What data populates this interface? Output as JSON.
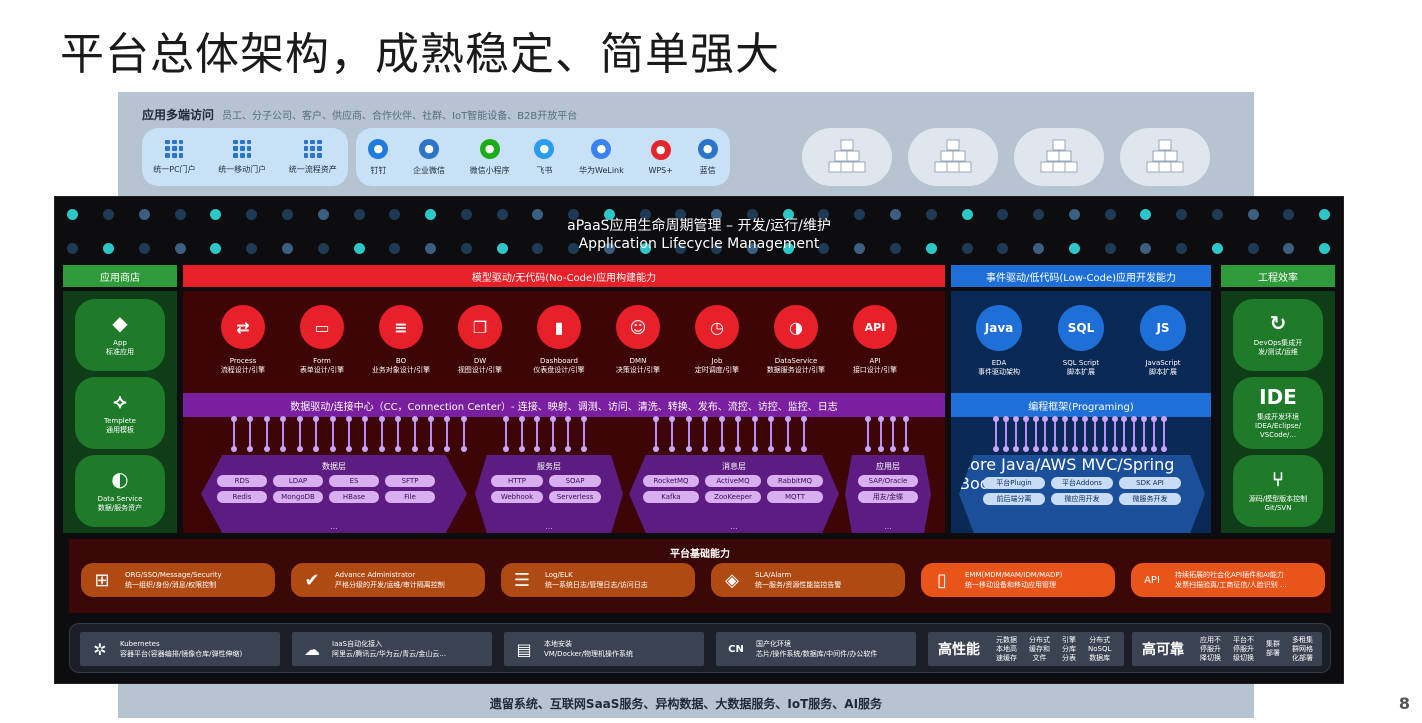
{
  "slide": {
    "title": "平台总体架构，成熟稳定、简单强大",
    "page_number": "8"
  },
  "access": {
    "header": "应用多端访问",
    "subtitle": "员工、分子公司、客户、供应商、合作伙伴、社群、IoT智能设备、B2B开放平台",
    "portals": [
      {
        "label": "统一PC门户"
      },
      {
        "label": "统一移动门户"
      },
      {
        "label": "统一流程资产"
      }
    ],
    "apps": [
      {
        "label": "钉钉",
        "icon": "dingtalk-icon",
        "color": "#1f7be0"
      },
      {
        "label": "企业微信",
        "icon": "wecom-icon",
        "color": "#2b74c9"
      },
      {
        "label": "微信小程序",
        "icon": "wechat-mini-icon",
        "color": "#1aad19"
      },
      {
        "label": "飞书",
        "icon": "feishu-icon",
        "color": "#2a9cf0"
      },
      {
        "label": "华为WeLink",
        "icon": "welink-icon",
        "color": "#3b82f6"
      },
      {
        "label": "WPS+",
        "icon": "wps-icon",
        "color": "#e3262b"
      },
      {
        "label": "蓝信",
        "icon": "lanxin-icon",
        "color": "#2b74c9"
      }
    ]
  },
  "bottom_bar": "遗留系统、互联网SaaS服务、异构数据、大数据服务、IoT服务、AI服务",
  "alm": {
    "title_cn": "aPaaS应用生命周期管理 – 开发/运行/维护",
    "title_en": "Application Lifecycle Management"
  },
  "columns": {
    "app_store": "应用商店",
    "no_code": "模型驱动/无代码(No-Code)应用构建能力",
    "low_code": "事件驱动/低代码(Low-Code)应用开发能力",
    "efficiency": "工程效率"
  },
  "app_store_items": [
    {
      "icon": "cube-icon",
      "glyph": "◆",
      "line1": "App",
      "line2": "标准应用"
    },
    {
      "icon": "template-icon",
      "glyph": "⟡",
      "line1": "Templete",
      "line2": "通用模板"
    },
    {
      "icon": "data-service-icon",
      "glyph": "◐",
      "line1": "Data Service",
      "line2": "数据/服务资产"
    }
  ],
  "no_code_items": [
    {
      "icon": "process-icon",
      "glyph": "⇄",
      "line1": "Process",
      "line2": "流程设计/引擎"
    },
    {
      "icon": "form-icon",
      "glyph": "▭",
      "line1": "Form",
      "line2": "表单设计/引擎"
    },
    {
      "icon": "bo-icon",
      "glyph": "≡",
      "line1": "BO",
      "line2": "业务对象设计/引擎"
    },
    {
      "icon": "dw-icon",
      "glyph": "❐",
      "line1": "DW",
      "line2": "视图设计/引擎"
    },
    {
      "icon": "dashboard-icon",
      "glyph": "▮",
      "line1": "Dashboard",
      "line2": "仪表盘设计/引擎"
    },
    {
      "icon": "dmn-icon",
      "glyph": "☺",
      "line1": "DMN",
      "line2": "决策设计/引擎"
    },
    {
      "icon": "job-icon",
      "glyph": "◷",
      "line1": "Job",
      "line2": "定时调度/引擎"
    },
    {
      "icon": "dataservice-icon",
      "glyph": "◑",
      "line1": "DataService",
      "line2": "数据服务设计/引擎"
    },
    {
      "icon": "api-icon",
      "glyph": "API",
      "line1": "API",
      "line2": "接口设计/引擎"
    }
  ],
  "low_code_items": [
    {
      "icon": "java-icon",
      "glyph": "Java",
      "line1": "EDA",
      "line2": "事件驱动架构"
    },
    {
      "icon": "sql-icon",
      "glyph": "SQL",
      "line1": "SQL Script",
      "line2": "脚本扩展"
    },
    {
      "icon": "js-icon",
      "glyph": "JS",
      "line1": "JavaScript",
      "line2": "脚本扩展"
    }
  ],
  "efficiency_items": [
    {
      "icon": "devops-icon",
      "glyph": "↻",
      "line1": "DevOps集成开",
      "line2": "发/测试/运维"
    },
    {
      "icon": "ide-icon",
      "glyph": "IDE",
      "line1": "集成开发环境",
      "line2": "IDEA/Eclipse/",
      "line3": "VSCode/..."
    },
    {
      "icon": "git-icon",
      "glyph": "⑂",
      "line1": "源码/模型版本控制",
      "line2": "Git/SVN"
    }
  ],
  "connection_center": "数据驱动/连接中心（CC，Connection Center）- 连接、映射、调测、访问、清洗、转换、发布、流控、访控、监控、日志",
  "programming": "编程框架(Programing)",
  "data_groups": [
    {
      "title": "数据层",
      "chips": [
        "RDS",
        "LDAP",
        "ES",
        "SFTP",
        "Redis",
        "MongoDB",
        "HBase",
        "File"
      ],
      "more": "..."
    },
    {
      "title": "服务层",
      "chips": [
        "HTTP",
        "SOAP",
        "Webhook",
        "Serverless"
      ],
      "more": "..."
    },
    {
      "title": "消息层",
      "chips": [
        "RocketMQ",
        "ActiveMQ",
        "RabbitMQ",
        "Kafka",
        "ZooKeeper",
        "MQTT"
      ],
      "more": "..."
    },
    {
      "title": "应用层",
      "chips": [
        "SAP/Oracle",
        "用友/金蝶"
      ],
      "more": "..."
    }
  ],
  "programming_group": {
    "title": "Core Java/AWS MVC/Spring Boot",
    "chips": [
      "平台Plugin",
      "平台Addons",
      "SDK API",
      "前后端分离",
      "微应用开发",
      "微服务开发"
    ]
  },
  "foundation": {
    "title": "平台基础能力",
    "items": [
      {
        "icon": "org-icon",
        "glyph": "⊞",
        "line1": "ORG/SSO/Message/Security",
        "line2": "统一组织/身份/消息/权限控制",
        "color": "#b04a13"
      },
      {
        "icon": "shield-icon",
        "glyph": "✔",
        "line1": "Advance Administrator",
        "line2": "严格分级的开发/运维/审计隔离控制",
        "color": "#b04a13"
      },
      {
        "icon": "log-icon",
        "glyph": "☰",
        "line1": "Log/ELK",
        "line2": "统一系统日志/管理日志/访问日志",
        "color": "#b04a13"
      },
      {
        "icon": "alarm-icon",
        "glyph": "◈",
        "line1": "SLA/Alarm",
        "line2": "统一服务/资源性能监控告警",
        "color": "#b04a13"
      },
      {
        "icon": "mobile-icon",
        "glyph": "▯",
        "line1": "EMM(MDM/MAM/IDM/MADP)",
        "line2": "统一移动设备和移动应用管理",
        "color": "#e8541a"
      },
      {
        "icon": "api-ext-icon",
        "glyph": "API",
        "line1": "持续拓展的社会化API插件和AI能力",
        "line2": "发票扫描验真/工商征信/人脸识别 ...",
        "color": "#e8541a"
      }
    ]
  },
  "infra": {
    "items": [
      {
        "icon": "kubernetes-icon",
        "glyph": "✲",
        "line1": "Kubernetes",
        "line2": "容器平台(容器编排/镜像仓库/弹性伸缩)"
      },
      {
        "icon": "cloud-icon",
        "glyph": "☁",
        "line1": "IaaS自动化接入",
        "line2": "阿里云/腾讯云/华为云/青云/金山云..."
      },
      {
        "icon": "server-icon",
        "glyph": "▤",
        "line1": "本地安装",
        "line2": "VM/Docker/物理机操作系统"
      },
      {
        "icon": "cn-icon",
        "glyph": "CN",
        "line1": "国产化环境",
        "line2": "芯片/操作系统/数据库/中间件/办公软件"
      }
    ],
    "performance": {
      "title": "高性能",
      "items": [
        [
          "元数据",
          "本地高",
          "速缓存"
        ],
        [
          "分布式",
          "缓存和",
          "文件"
        ],
        [
          "引擎",
          "分库",
          "分表"
        ],
        [
          "分布式",
          "NoSQL",
          "数据库"
        ]
      ]
    },
    "availability": {
      "title": "高可靠",
      "items": [
        [
          "应用不",
          "停服升",
          "降切换"
        ],
        [
          "平台不",
          "停服升",
          "级切换"
        ],
        [
          "集群",
          "部署"
        ],
        [
          "多租集",
          "群网格",
          "化部署"
        ]
      ]
    }
  }
}
